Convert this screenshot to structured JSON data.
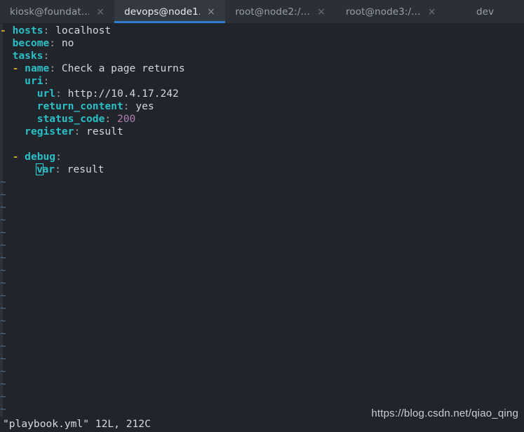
{
  "window": {
    "title": "devops@node1: ~",
    "accent_blue": "#2f7fd1",
    "background": "#21252b",
    "tabbar_background": "#2b2f36"
  },
  "tabbar": {
    "close_glyph": "×",
    "tabs": [
      {
        "label": "kiosk@foundat…",
        "active": false
      },
      {
        "label": "devops@node1…",
        "active": true
      },
      {
        "label": "root@node2:/…",
        "active": false
      },
      {
        "label": "root@node3:/…",
        "active": false
      },
      {
        "label": "dev",
        "active": false
      }
    ]
  },
  "editor": {
    "filename": "playbook.yml",
    "cursor": {
      "line": 10,
      "column": 5,
      "char": "v"
    },
    "empty_line_marker": "~",
    "empty_line_count": 19,
    "lines": [
      {
        "n": 1,
        "segments": [
          {
            "t": "- ",
            "c": "dash"
          },
          {
            "t": "hosts",
            "c": "key"
          },
          {
            "t": ":",
            "c": "punct"
          },
          {
            "t": " localhost",
            "c": "val"
          }
        ]
      },
      {
        "n": 2,
        "segments": [
          {
            "t": "  ",
            "c": "val"
          },
          {
            "t": "become",
            "c": "key"
          },
          {
            "t": ":",
            "c": "punct"
          },
          {
            "t": " no",
            "c": "val"
          }
        ]
      },
      {
        "n": 3,
        "segments": [
          {
            "t": "  ",
            "c": "val"
          },
          {
            "t": "tasks",
            "c": "key"
          },
          {
            "t": ":",
            "c": "punct"
          }
        ]
      },
      {
        "n": 4,
        "segments": [
          {
            "t": "  - ",
            "c": "dash"
          },
          {
            "t": "name",
            "c": "key"
          },
          {
            "t": ":",
            "c": "punct"
          },
          {
            "t": " Check a page returns",
            "c": "val"
          }
        ]
      },
      {
        "n": 5,
        "segments": [
          {
            "t": "    ",
            "c": "val"
          },
          {
            "t": "uri",
            "c": "key"
          },
          {
            "t": ":",
            "c": "punct"
          }
        ]
      },
      {
        "n": 6,
        "segments": [
          {
            "t": "      ",
            "c": "val"
          },
          {
            "t": "url",
            "c": "key"
          },
          {
            "t": ":",
            "c": "punct"
          },
          {
            "t": " http://10.4.17.242",
            "c": "val"
          }
        ]
      },
      {
        "n": 7,
        "segments": [
          {
            "t": "      ",
            "c": "val"
          },
          {
            "t": "return_content",
            "c": "key"
          },
          {
            "t": ":",
            "c": "punct"
          },
          {
            "t": " yes",
            "c": "val"
          }
        ]
      },
      {
        "n": 8,
        "segments": [
          {
            "t": "      ",
            "c": "val"
          },
          {
            "t": "status_code",
            "c": "key"
          },
          {
            "t": ":",
            "c": "punct"
          },
          {
            "t": " ",
            "c": "val"
          },
          {
            "t": "200",
            "c": "num"
          }
        ]
      },
      {
        "n": 9,
        "segments": [
          {
            "t": "    ",
            "c": "val"
          },
          {
            "t": "register",
            "c": "key"
          },
          {
            "t": ":",
            "c": "punct"
          },
          {
            "t": " result",
            "c": "val"
          }
        ]
      },
      {
        "n": 10,
        "segments": []
      },
      {
        "n": 11,
        "segments": [
          {
            "t": "  - ",
            "c": "dash"
          },
          {
            "t": "debug",
            "c": "key"
          },
          {
            "t": ":",
            "c": "punct"
          }
        ]
      },
      {
        "n": 12,
        "segments": [
          {
            "t": "      ",
            "c": "val"
          },
          {
            "t": "v",
            "c": "cursor"
          },
          {
            "t": "ar",
            "c": "key"
          },
          {
            "t": ":",
            "c": "punct"
          },
          {
            "t": " result",
            "c": "val"
          }
        ]
      }
    ]
  },
  "statusline": {
    "text": "\"playbook.yml\" 12L, 212C"
  },
  "watermark": {
    "text": "https://blog.csdn.net/qiao_qing"
  }
}
